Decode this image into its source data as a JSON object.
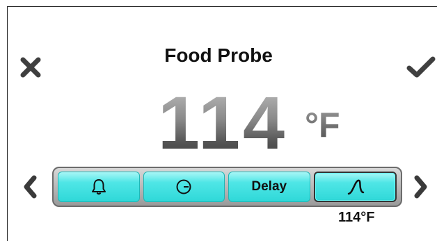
{
  "header": {
    "title": "Food Probe",
    "cancel_icon": "close-icon",
    "confirm_icon": "checkmark-icon"
  },
  "temperature": {
    "value": "114",
    "unit": "°F"
  },
  "mode_bar": {
    "tabs": [
      {
        "name": "alarm",
        "icon": "bell-icon",
        "label": ""
      },
      {
        "name": "timer",
        "icon": "clock-icon",
        "label": ""
      },
      {
        "name": "delay",
        "icon": "",
        "label": "Delay"
      },
      {
        "name": "food-probe",
        "icon": "probe-icon",
        "label": "",
        "selected": true
      }
    ],
    "probe_readout": "114°F"
  },
  "navigation": {
    "prev_icon": "chevron-left-icon",
    "next_icon": "chevron-right-icon"
  },
  "colors": {
    "tab_accent": "#3ddddd",
    "tab_border": "#1fb6b6",
    "temp_gray": "#6a6a6a"
  }
}
